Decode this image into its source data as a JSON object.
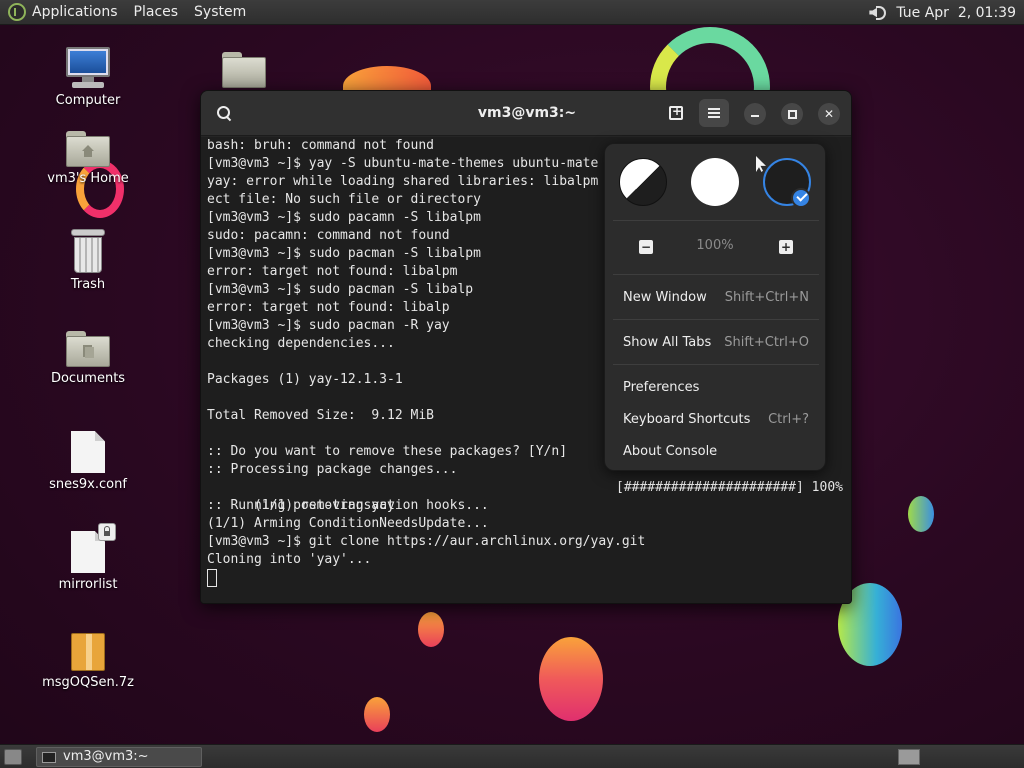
{
  "top_panel": {
    "menus": [
      "Applications",
      "Places",
      "System"
    ],
    "clock": "Tue Apr  2, 01:39"
  },
  "desktop_icons": [
    {
      "label": "Computer",
      "icon": "computer-icon"
    },
    {
      "label": "vm3's Home",
      "icon": "home-folder-icon"
    },
    {
      "label": "Trash",
      "icon": "trash-icon"
    },
    {
      "label": "Documents",
      "icon": "documents-folder-icon"
    },
    {
      "label": "snes9x.conf",
      "icon": "text-file-icon"
    },
    {
      "label": "mirrorlist",
      "icon": "locked-file-icon"
    },
    {
      "label": "msgOQSen.7z",
      "icon": "archive-icon"
    }
  ],
  "console": {
    "title": "vm3@vm3:~",
    "lines": [
      "bash: bruh: command not found",
      "[vm3@vm3 ~]$ yay -S ubuntu-mate-themes ubuntu-mate",
      "yay: error while loading shared libraries: libalpm                          obj",
      "ect file: No such file or directory",
      "[vm3@vm3 ~]$ sudo pacamn -S libalpm",
      "sudo: pacamn: command not found",
      "[vm3@vm3 ~]$ sudo pacman -S libalpm",
      "error: target not found: libalpm",
      "[vm3@vm3 ~]$ sudo pacman -S libalp",
      "error: target not found: libalp",
      "[vm3@vm3 ~]$ sudo pacman -R yay",
      "checking dependencies...",
      "",
      "Packages (1) yay-12.1.3-1",
      "",
      "Total Removed Size:  9.12 MiB",
      "",
      ":: Do you want to remove these packages? [Y/n]",
      ":: Processing package changes...",
      "(1/1) removing yay",
      ":: Running post-transaction hooks...",
      "(1/1) Arming ConditionNeedsUpdate...",
      "[vm3@vm3 ~]$ git clone https://aur.archlinux.org/yay.git",
      "Cloning into 'yay'..."
    ],
    "progress_text": "[######################] 100%"
  },
  "menu": {
    "zoom_level": "100%",
    "zoom_out": "−",
    "zoom_in": "+",
    "items": [
      {
        "label": "New Window",
        "shortcut": "Shift+Ctrl+N"
      },
      {
        "label": "Show All Tabs",
        "shortcut": "Shift+Ctrl+O"
      },
      {
        "label": "Preferences",
        "shortcut": ""
      },
      {
        "label": "Keyboard Shortcuts",
        "shortcut": "Ctrl+?"
      },
      {
        "label": "About Console",
        "shortcut": ""
      }
    ]
  },
  "taskbar": {
    "window_label": "vm3@vm3:~"
  },
  "colors": {
    "accent": "#3584e4",
    "wallpaper": "#2a0821"
  }
}
